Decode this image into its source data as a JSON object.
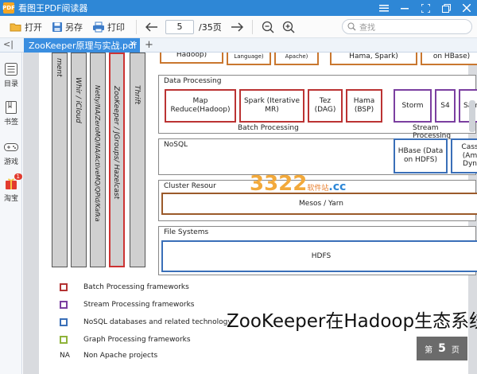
{
  "window": {
    "app_title": "看图王PDF阅读器",
    "logo_text": "PDF"
  },
  "toolbar": {
    "open_label": "打开",
    "saveas_label": "另存",
    "print_label": "打印",
    "current_page": "5",
    "total_pages": "/35页",
    "search_placeholder": "查找"
  },
  "tabs": {
    "active_tab": "ZooKeeper原理与实战.pdf",
    "collapse_glyph": "<|",
    "add_glyph": "+"
  },
  "sidebar": {
    "items": [
      {
        "label": "目录",
        "icon": "list-icon"
      },
      {
        "label": "书签",
        "icon": "bookmark-icon"
      },
      {
        "label": "游戏",
        "icon": "gamepad-icon"
      },
      {
        "label": "淘宝",
        "icon": "gift-icon",
        "badge": "1"
      }
    ]
  },
  "doc": {
    "vertical_columns": [
      "ment",
      "Whir / iCloud",
      "Netty/NA/ZeroMQ/NA/ActiveMQ/QPid/Kafka",
      "ZooKeeper / JGroups/ Hazelcast",
      "Thrift"
    ],
    "top_row": [
      "Hadoop)",
      "Language)",
      "Apache)",
      "Hama, Spark)",
      "on HBase)"
    ],
    "data_processing": {
      "title": "Data Processing",
      "boxes": [
        "Map Reduce(Hadoop)",
        "Spark (Iterative MR)",
        "Tez (DAG)",
        "Hama (BSP)"
      ],
      "stream_boxes": [
        "Storm",
        "S4",
        "Sam"
      ],
      "batch_label": "Batch Processing",
      "stream_label": "Stream Processing"
    },
    "nosql": {
      "title": "NoSQL",
      "boxes": [
        "HBase (Data on HDFS)",
        "Cass (Am Dyn"
      ]
    },
    "cluster": {
      "title": "Cluster Resour",
      "box": "Mesos / Yarn"
    },
    "filesystems": {
      "title": "File Systems",
      "box": "HDFS"
    },
    "legend": [
      {
        "text": "Batch Processing frameworks",
        "color": "#b33333"
      },
      {
        "text": "Stream Processing frameworks",
        "color": "#7b3fa0"
      },
      {
        "text": "NoSQL databases and related technology",
        "color": "#3a6fb8"
      },
      {
        "text": "Graph Processing frameworks",
        "color": "#8fb33a"
      },
      {
        "text": "Non Apache projects",
        "mark": "NA"
      }
    ],
    "caption": "ZooKeeper在Hadoop生态系统",
    "page_badge": {
      "prefix": "第",
      "num": "5",
      "suffix": "页"
    },
    "watermark": {
      "main": "3322",
      "sub": "软件站",
      "suffix": ".cc"
    }
  }
}
